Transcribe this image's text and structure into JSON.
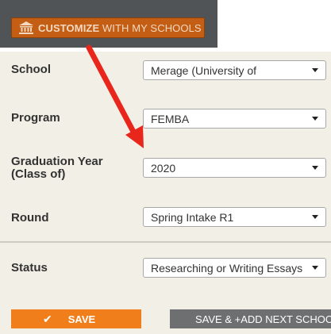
{
  "customize": {
    "label_bold": "CUSTOMIZE",
    "label_rest": " WITH MY SCHOOLS",
    "icon": "institution-icon"
  },
  "form": {
    "school": {
      "label": "School",
      "value": "Merage (University of"
    },
    "program": {
      "label": "Program",
      "value": "FEMBA"
    },
    "graduation": {
      "label_line1": "Graduation Year",
      "label_line2": "(Class of)",
      "value": "2020"
    },
    "round": {
      "label": "Round",
      "value": "Spring Intake R1"
    },
    "status": {
      "label": "Status",
      "value": "Researching or Writing Essays"
    }
  },
  "actions": {
    "save_label": "SAVE",
    "save_icon": "checkmark-icon",
    "next_label": "SAVE & +ADD NEXT SCHOOL"
  },
  "colors": {
    "banner": "#515456",
    "customize_button": "#c35e14",
    "panel": "#f2efe6",
    "save_button": "#f07f1b",
    "next_button": "#6e6f71",
    "annotation_arrow": "#e8261c"
  }
}
